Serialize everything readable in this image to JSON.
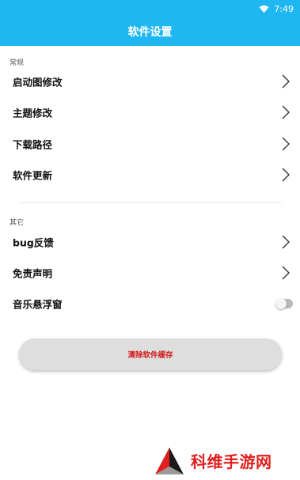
{
  "status_bar": {
    "time": "7:49",
    "wifi_icon": "wifi-icon"
  },
  "app_bar": {
    "title": "软件设置"
  },
  "sections": {
    "general": {
      "header": "常规",
      "items": [
        "启动图修改",
        "主题修改",
        "下载路径",
        "软件更新"
      ]
    },
    "other": {
      "header": "其它",
      "items": [
        "bug反馈",
        "免责声明",
        "音乐悬浮窗"
      ]
    }
  },
  "floating_music_toggle": {
    "on": false
  },
  "actions": {
    "clear_cache_label": "清除软件缓存"
  },
  "watermark": {
    "text": "科维手游网"
  },
  "colors": {
    "app_bar": "#1eb7f1",
    "clear_text": "#d31d1d",
    "watermark": "#e02020"
  }
}
